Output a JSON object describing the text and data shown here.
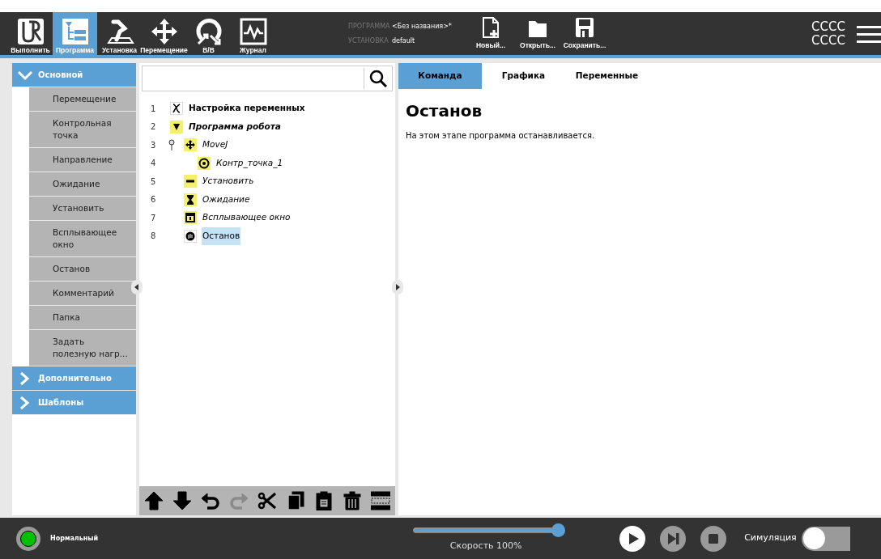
{
  "nav_tabs": [
    {
      "kind": "run",
      "label": "Выполнить",
      "selected": false
    },
    {
      "kind": "program",
      "label": "Программа",
      "selected": true
    },
    {
      "kind": "installation",
      "label": "Установка",
      "selected": false
    },
    {
      "kind": "move",
      "label": "Перемещение",
      "selected": false
    },
    {
      "kind": "io",
      "label": "В/В",
      "selected": false
    },
    {
      "kind": "log",
      "label": "Журнал",
      "selected": false
    }
  ],
  "file_info": {
    "program_label": "ПРОГРАММА",
    "program_value": "<Без названия>*",
    "installation_label": "УСТАНОВКА",
    "installation_value": "default"
  },
  "file_buttons": [
    {
      "kind": "new",
      "label": "Новый..."
    },
    {
      "kind": "open",
      "label": "Открыть..."
    },
    {
      "kind": "save",
      "label": "Сохранить..."
    }
  ],
  "top_right": [
    "CCCC",
    "CCCC"
  ],
  "sidebar": [
    {
      "title": "Основной",
      "expanded": true,
      "items": [
        "Перемещение",
        "Контрольная точка",
        "Направление",
        "Ожидание",
        "Установить",
        "Всплывающее окно",
        "Останов",
        "Комментарий",
        "Папка",
        "Задать полезную нагр..."
      ]
    },
    {
      "title": "Дополнительно",
      "expanded": false
    },
    {
      "title": "Шаблоны",
      "expanded": false
    }
  ],
  "tree": [
    {
      "number": "1",
      "label": "Настройка переменных",
      "kind": "variables",
      "bold": true,
      "italic": false,
      "selected": false
    },
    {
      "number": "2",
      "label": "Программа робота",
      "kind": "program",
      "bold": true,
      "italic": true,
      "selected": false,
      "children": [
        {
          "number": "3",
          "label": "MoveJ",
          "kind": "move",
          "bold": false,
          "italic": true,
          "selected": false,
          "expanded": true,
          "children": [
            {
              "number": "4",
              "label": "Контр_точка_1",
              "kind": "waypoint",
              "bold": false,
              "italic": true,
              "selected": false
            }
          ]
        },
        {
          "number": "5",
          "label": "Установить",
          "kind": "set",
          "bold": false,
          "italic": true,
          "selected": false
        },
        {
          "number": "6",
          "label": "Ожидание",
          "kind": "wait",
          "bold": false,
          "italic": true,
          "selected": false
        },
        {
          "number": "7",
          "label": "Всплывающее окно",
          "kind": "popup",
          "bold": false,
          "italic": true,
          "selected": false
        },
        {
          "number": "8",
          "label": "Останов",
          "kind": "halt",
          "bold": false,
          "italic": false,
          "selected": true
        }
      ]
    }
  ],
  "tree_toolbar": [
    {
      "kind": "up",
      "disabled": false
    },
    {
      "kind": "down",
      "disabled": false
    },
    {
      "kind": "undo",
      "disabled": false
    },
    {
      "kind": "redo",
      "disabled": true
    },
    {
      "kind": "cut",
      "disabled": false
    },
    {
      "kind": "copy",
      "disabled": false
    },
    {
      "kind": "paste",
      "disabled": false
    },
    {
      "kind": "delete",
      "disabled": false
    },
    {
      "kind": "suppress",
      "disabled": false
    }
  ],
  "detail_tabs": [
    {
      "label": "Команда",
      "selected": true
    },
    {
      "label": "Графика",
      "selected": false
    },
    {
      "label": "Переменные",
      "selected": false
    }
  ],
  "detail": {
    "title": "Останов",
    "description": "На этом этапе программа останавливается."
  },
  "status_bar": {
    "ok": true,
    "status": "Нормальный",
    "level": 1.0,
    "speed": "Скорость 100%",
    "simulation_label": "Симуляция",
    "simulation_on": false
  }
}
